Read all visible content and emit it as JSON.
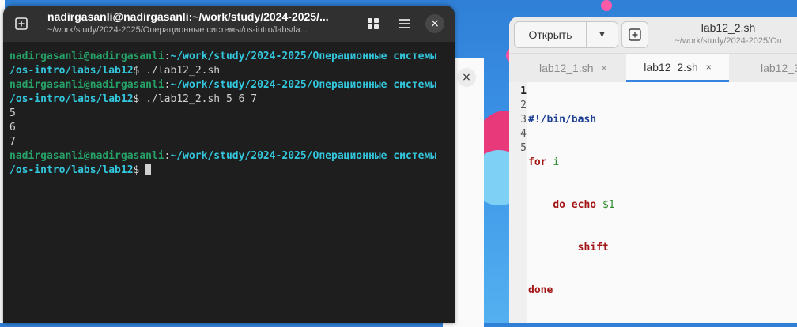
{
  "terminal": {
    "title": "nadirgasanli@nadirgasanli:~/work/study/2024-2025/...",
    "subtitle": "~/work/study/2024-2025/Операционные системы/os-intro/labs/la...",
    "lines": [
      {
        "user": "nadirgasanli@nadirgasanli",
        "sep": ":",
        "path": "~/work/study/2024-2025/Операционные системы"
      },
      {
        "path": "/os-intro/labs/lab12",
        "sym": "$ ",
        "cmd": "./lab12_2.sh"
      },
      {
        "user": "nadirgasanli@nadirgasanli",
        "sep": ":",
        "path": "~/work/study/2024-2025/Операционные системы"
      },
      {
        "path": "/os-intro/labs/lab12",
        "sym": "$ ",
        "cmd": "./lab12_2.sh 5 6 7"
      },
      {
        "out": "5"
      },
      {
        "out": "6"
      },
      {
        "out": "7"
      },
      {
        "user": "nadirgasanli@nadirgasanli",
        "sep": ":",
        "path": "~/work/study/2024-2025/Операционные системы"
      },
      {
        "path": "/os-intro/labs/lab12",
        "sym": "$ "
      }
    ]
  },
  "editor": {
    "open_label": "Открыть",
    "title": "lab12_2.sh",
    "subtitle": "~/work/study/2024-2025/Оп",
    "tabs": [
      {
        "label": "lab12_1.sh",
        "close": "×"
      },
      {
        "label": "lab12_2.sh",
        "close": "×"
      },
      {
        "label": "lab12_3"
      }
    ],
    "line_numbers": [
      "1",
      "2",
      "3",
      "4",
      "5"
    ],
    "code": {
      "l1": "#!/bin/bash",
      "l2_kw": "for",
      "l2_var": "i",
      "l3_kw1": "do",
      "l3_kw2": "echo",
      "l3_var": "$1",
      "l4_kw": "shift",
      "l5_kw": "done"
    }
  },
  "back_window": {
    "close": "×"
  }
}
